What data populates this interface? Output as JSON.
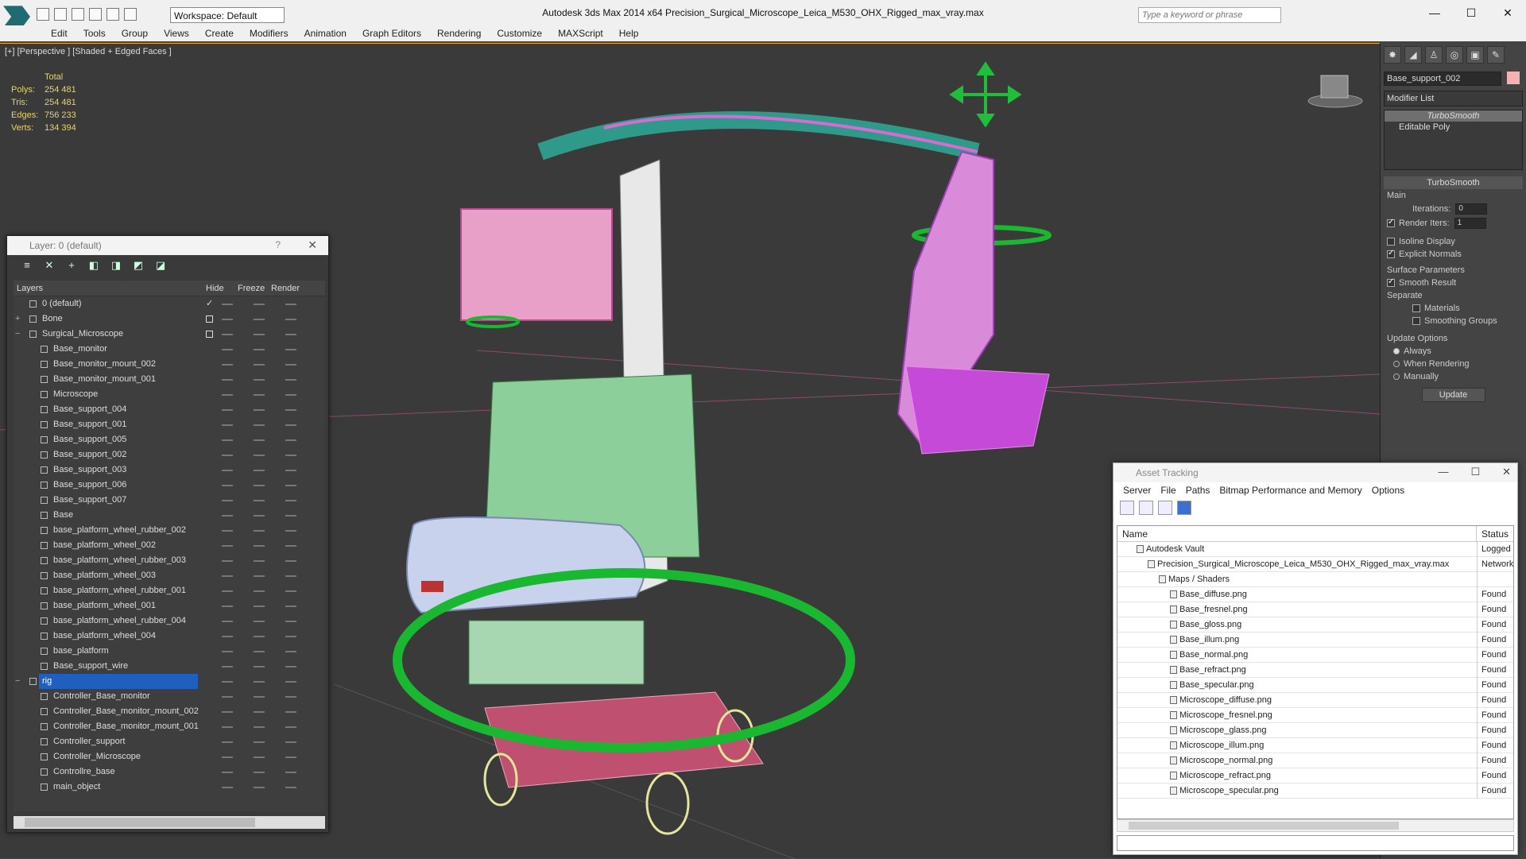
{
  "app": {
    "window_title": "Autodesk 3ds Max  2014 x64      Precision_Surgical_Microscope_Leica_M530_OHX_Rigged_max_vray.max",
    "workspace": "Workspace: Default",
    "search_placeholder": "Type a keyword or phrase",
    "window_controls": [
      "—",
      "☐",
      "✕"
    ]
  },
  "menu": [
    "Edit",
    "Tools",
    "Group",
    "Views",
    "Create",
    "Modifiers",
    "Animation",
    "Graph Editors",
    "Rendering",
    "Customize",
    "MAXScript",
    "Help"
  ],
  "viewport": {
    "label": "[+] [Perspective ] [Shaded + Edged Faces ]",
    "stats": {
      "header": "Total",
      "rows": [
        {
          "k": "Polys:",
          "v": "254 481"
        },
        {
          "k": "Tris:",
          "v": "254 481"
        },
        {
          "k": "Edges:",
          "v": "756 233"
        },
        {
          "k": "Verts:",
          "v": "134 394"
        }
      ]
    }
  },
  "layer_panel": {
    "title": "Layer: 0 (default)",
    "help": "?",
    "close": "✕",
    "columns": {
      "layers": "Layers",
      "hide": "Hide",
      "freeze": "Freeze",
      "render": "Render"
    },
    "rows": [
      {
        "name": "0 (default)",
        "indent": 1,
        "check": "✓"
      },
      {
        "name": "Bone",
        "indent": 1,
        "check": "",
        "expand": "+"
      },
      {
        "name": "Surgical_Microscope",
        "indent": 1,
        "check": "",
        "expand": "−"
      },
      {
        "name": "Base_monitor",
        "indent": 2
      },
      {
        "name": "Base_monitor_mount_002",
        "indent": 2
      },
      {
        "name": "Base_monitor_mount_001",
        "indent": 2
      },
      {
        "name": "Microscope",
        "indent": 2
      },
      {
        "name": "Base_support_004",
        "indent": 2
      },
      {
        "name": "Base_support_001",
        "indent": 2
      },
      {
        "name": "Base_support_005",
        "indent": 2
      },
      {
        "name": "Base_support_002",
        "indent": 2
      },
      {
        "name": "Base_support_003",
        "indent": 2
      },
      {
        "name": "Base_support_006",
        "indent": 2
      },
      {
        "name": "Base_support_007",
        "indent": 2
      },
      {
        "name": "Base",
        "indent": 2
      },
      {
        "name": "base_platform_wheel_rubber_002",
        "indent": 2
      },
      {
        "name": "base_platform_wheel_002",
        "indent": 2
      },
      {
        "name": "base_platform_wheel_rubber_003",
        "indent": 2
      },
      {
        "name": "base_platform_wheel_003",
        "indent": 2
      },
      {
        "name": "base_platform_wheel_rubber_001",
        "indent": 2
      },
      {
        "name": "base_platform_wheel_001",
        "indent": 2
      },
      {
        "name": "base_platform_wheel_rubber_004",
        "indent": 2
      },
      {
        "name": "base_platform_wheel_004",
        "indent": 2
      },
      {
        "name": "base_platform",
        "indent": 2
      },
      {
        "name": "Base_support_wire",
        "indent": 2
      },
      {
        "name": "rig",
        "indent": 1,
        "selected": true,
        "expand": "−"
      },
      {
        "name": "Controller_Base_monitor",
        "indent": 2
      },
      {
        "name": "Controller_Base_monitor_mount_002",
        "indent": 2
      },
      {
        "name": "Controller_Base_monitor_mount_001",
        "indent": 2
      },
      {
        "name": "Controller_support",
        "indent": 2
      },
      {
        "name": "Controller_Microscope",
        "indent": 2
      },
      {
        "name": "Controllre_base",
        "indent": 2
      },
      {
        "name": "main_object",
        "indent": 2
      }
    ]
  },
  "command_panel": {
    "object_name": "Base_support_002",
    "object_color": "#f4b2b2",
    "modifier_list": "Modifier List",
    "stack": [
      "TurboSmooth",
      "Editable Poly"
    ],
    "rollout": "TurboSmooth",
    "main_label": "Main",
    "iterations_label": "Iterations:",
    "iterations": "0",
    "render_iters_label": "Render Iters:",
    "render_iters": "1",
    "isoline": "Isoline Display",
    "explicit_normals": "Explicit Normals",
    "surface_params": "Surface Parameters",
    "smooth_result": "Smooth Result",
    "separate": "Separate",
    "materials": "Materials",
    "smoothing_groups": "Smoothing Groups",
    "update_options": "Update Options",
    "always": "Always",
    "when_rendering": "When Rendering",
    "manually": "Manually",
    "update_btn": "Update"
  },
  "asset_tracking": {
    "title": "Asset Tracking",
    "menu": [
      "Server",
      "File",
      "Paths",
      "Bitmap Performance and Memory",
      "Options"
    ],
    "columns": {
      "name": "Name",
      "status": "Status"
    },
    "rows": [
      {
        "name": "Autodesk Vault",
        "status": "Logged O",
        "indent": 1
      },
      {
        "name": "Precision_Surgical_Microscope_Leica_M530_OHX_Rigged_max_vray.max",
        "status": "Network",
        "indent": 2
      },
      {
        "name": "Maps / Shaders",
        "status": "",
        "indent": 3
      },
      {
        "name": "Base_diffuse.png",
        "status": "Found",
        "indent": 4
      },
      {
        "name": "Base_fresnel.png",
        "status": "Found",
        "indent": 4
      },
      {
        "name": "Base_gloss.png",
        "status": "Found",
        "indent": 4
      },
      {
        "name": "Base_illum.png",
        "status": "Found",
        "indent": 4
      },
      {
        "name": "Base_normal.png",
        "status": "Found",
        "indent": 4
      },
      {
        "name": "Base_refract.png",
        "status": "Found",
        "indent": 4
      },
      {
        "name": "Base_specular.png",
        "status": "Found",
        "indent": 4
      },
      {
        "name": "Microscope_diffuse.png",
        "status": "Found",
        "indent": 4
      },
      {
        "name": "Microscope_fresnel.png",
        "status": "Found",
        "indent": 4
      },
      {
        "name": "Microscope_glass.png",
        "status": "Found",
        "indent": 4
      },
      {
        "name": "Microscope_illum.png",
        "status": "Found",
        "indent": 4
      },
      {
        "name": "Microscope_normal.png",
        "status": "Found",
        "indent": 4
      },
      {
        "name": "Microscope_refract.png",
        "status": "Found",
        "indent": 4
      },
      {
        "name": "Microscope_specular.png",
        "status": "Found",
        "indent": 4
      }
    ]
  }
}
